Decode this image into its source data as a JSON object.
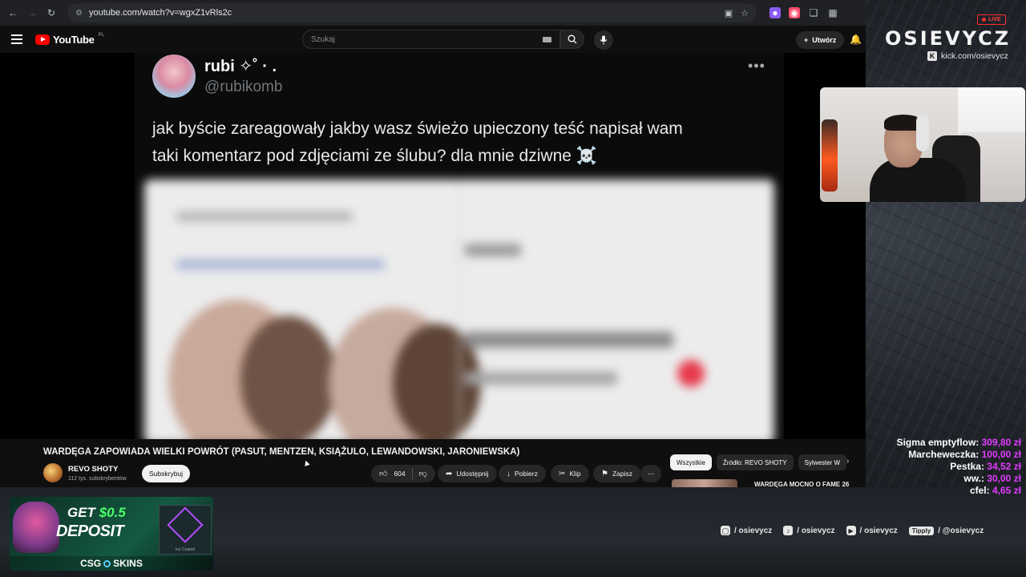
{
  "browser": {
    "url": "youtube.com/watch?v=wgxZ1vRls2c"
  },
  "youtube": {
    "logo_text": "YouTube",
    "region": "PL",
    "search_placeholder": "Szukaj",
    "create_label": "Utwórz"
  },
  "tweet": {
    "name": "rubi ✧˚ · .",
    "handle": "@rubikomb",
    "text_line1": "jak byście zareagowały jakby wasz świeżo upieczony teść napisał wam",
    "text_line2": "taki komentarz pod zdjęciami ze ślubu? dla mnie dziwne ☠️"
  },
  "video_info": {
    "title": "WARDĘGA ZAPOWIADA WIELKI POWRÓT (PASUT, MENTZEN, KSIĄŻULO, LEWANDOWSKI, JARONIEWSKA)",
    "channel_name": "REVO SHOTY",
    "subscribers": "112 tys. subskrybentów",
    "subscribe_label": "Subskrybuj",
    "likes": "604",
    "share_label": "Udostępnij",
    "download_label": "Pobierz",
    "clip_label": "Klip",
    "save_label": "Zapisz",
    "chips": [
      "Wszystkie",
      "Źródło: REVO SHOTY",
      "Sylwester W"
    ],
    "rec_title": "WARDĘGA MOCNO O FAME 26"
  },
  "overlay": {
    "live_label": "LIVE",
    "brand": "OSIEVYCZ",
    "kick": "kick.com/osievycz",
    "donations": [
      {
        "who": "Sigma emptyflow:",
        "amount": "309,80 zł"
      },
      {
        "who": "Marcheweczka:",
        "amount": "100,00 zł"
      },
      {
        "who": "Pestka:",
        "amount": "34,52 zł"
      },
      {
        "who": "ww.:",
        "amount": "30,00 zł"
      },
      {
        "who": "cfel:",
        "amount": "4,65 zł"
      }
    ],
    "ad": {
      "line1_prefix": "GET",
      "line1_amount": "$0.5",
      "line2": "DEPOSIT",
      "case_label": "Ice Coated",
      "brand_a": "CSG",
      "brand_b": "SKINS"
    },
    "socials": {
      "instagram": "/ osievycz",
      "tiktok": "/ osievycz",
      "youtube": "/ osievycz",
      "tipply_badge": "Tipply",
      "tipply": "/ @osievycz"
    }
  },
  "colors": {
    "youtube_red": "#ff0000",
    "donation_amount": "#e23cff",
    "live_red": "#ff2b2b"
  }
}
